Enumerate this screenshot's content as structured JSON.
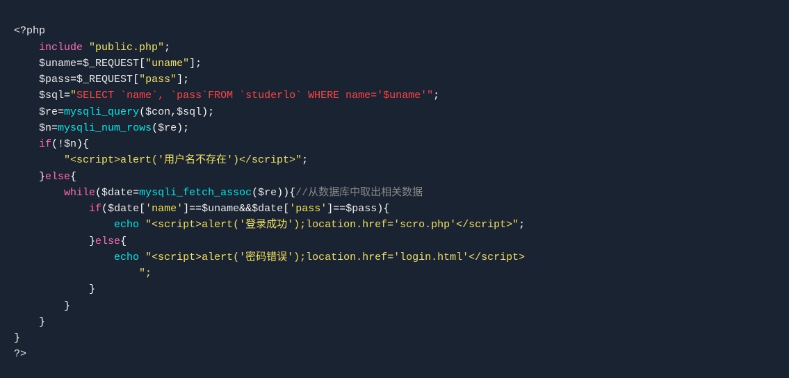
{
  "code": {
    "lines": [
      {
        "id": "line1",
        "content": "php_open_tag"
      },
      {
        "id": "line2",
        "content": "include_line"
      },
      {
        "id": "line3",
        "content": "uname_line"
      },
      {
        "id": "line4",
        "content": "pass_line"
      },
      {
        "id": "line5",
        "content": "sql_line"
      },
      {
        "id": "line6",
        "content": "re_line"
      },
      {
        "id": "line7",
        "content": "n_line"
      },
      {
        "id": "line8",
        "content": "if_line"
      },
      {
        "id": "line9",
        "content": "echo_script_line"
      },
      {
        "id": "line10",
        "content": "else_open"
      },
      {
        "id": "line11",
        "content": "while_line"
      },
      {
        "id": "line12",
        "content": "if_date_line"
      },
      {
        "id": "line13",
        "content": "echo_success_line"
      },
      {
        "id": "line14",
        "content": "else_inner_open"
      },
      {
        "id": "line15",
        "content": "echo_error_line"
      },
      {
        "id": "line16",
        "content": "str_cont_line"
      },
      {
        "id": "line17",
        "content": "brace_close_inner"
      },
      {
        "id": "line18",
        "content": "brace_close_while"
      },
      {
        "id": "line19",
        "content": "brace_close_else"
      },
      {
        "id": "line20",
        "content": "brace_close_top"
      },
      {
        "id": "line21",
        "content": "php_close_tag"
      }
    ]
  }
}
